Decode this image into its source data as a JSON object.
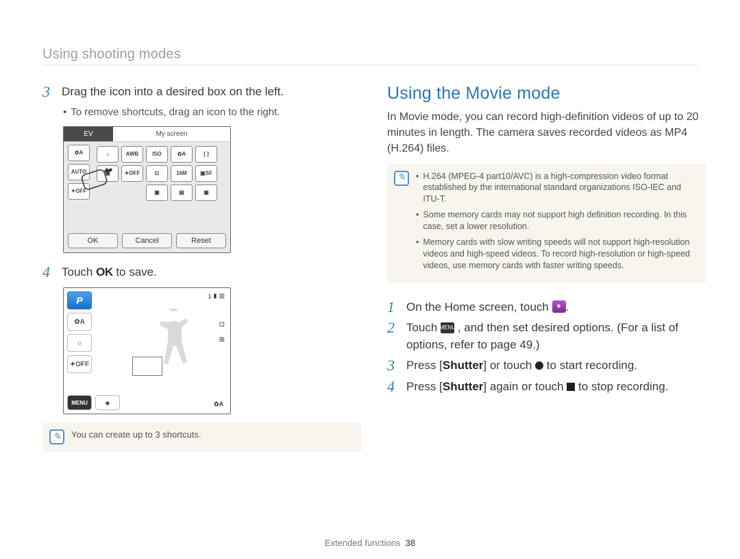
{
  "breadcrumb": "Using shooting modes",
  "left": {
    "step3": {
      "num": "3",
      "text": "Drag the icon into a desired box on the left.",
      "bullet": "To remove shortcuts, drag an icon to the right."
    },
    "shot1": {
      "tab_ev": "EV",
      "tab_label": "My screen",
      "row1": [
        "✿A",
        "☼",
        "AWB",
        "ISO",
        "✿A",
        "[ ]"
      ],
      "row2": [
        "AUTO",
        "▣",
        "✦OFF",
        "⊡",
        "16M",
        "▣SF"
      ],
      "row3": [
        "✦OFF",
        "",
        "",
        "▣",
        "▤",
        "▣"
      ],
      "btn_ok": "OK",
      "btn_cancel": "Cancel",
      "btn_reset": "Reset"
    },
    "step4": {
      "num": "4",
      "pre": "Touch ",
      "ok": "OK",
      "post": " to save."
    },
    "shot2": {
      "p": "P",
      "left_icons": [
        "✿A",
        "☼",
        "✦OFF"
      ],
      "menu": "MENU",
      "top_count": "1",
      "bottom_right": "✿A"
    },
    "note1": "You can create up to 3 shortcuts."
  },
  "right": {
    "title": "Using the Movie mode",
    "intro": "In Movie mode, you can record high-definition videos of up to 20 minutes in length. The camera saves recorded videos as MP4 (H.264) files.",
    "notes": [
      "H.264 (MPEG-4 part10/AVC) is a high-compression video format established by the international standard organizations ISO-IEC and ITU-T.",
      "Some memory cards may not support high definition recording. In this case, set a lower resolution.",
      "Memory cards with slow writing speeds will not support high-resolution videos and high-speed videos. To record high-resolution or high-speed videos, use memory cards with faster writing speeds."
    ],
    "step1": {
      "num": "1",
      "pre": "On the Home screen, touch ",
      "post": "."
    },
    "step2": {
      "num": "2",
      "pre": "Touch ",
      "menu": "MENU",
      "post": ", and then set desired options. (For a list of options, refer to page 49.)"
    },
    "step3": {
      "num": "3",
      "pre": "Press [",
      "shutter": "Shutter",
      "mid": "] or touch ",
      "post": " to start recording."
    },
    "step4": {
      "num": "4",
      "pre": "Press [",
      "shutter": "Shutter",
      "mid": "] again or touch ",
      "post": " to stop recording."
    }
  },
  "footer": {
    "section": "Extended functions",
    "page": "38"
  }
}
